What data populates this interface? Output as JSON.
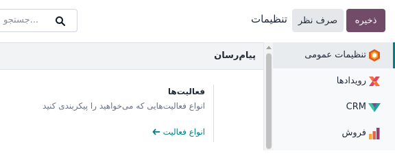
{
  "control_panel": {
    "save_label": "ذخیره",
    "discard_label": "صرف نظر",
    "title": "تنظیمات",
    "search_placeholder": "جستجو..."
  },
  "sidebar": {
    "items": [
      {
        "label": "تنظیمات عمومی",
        "icon": "settings-hex-icon",
        "active": true
      },
      {
        "label": "رویدادها",
        "icon": "events-icon",
        "active": false
      },
      {
        "label": "CRM",
        "icon": "crm-icon",
        "active": false
      },
      {
        "label": "فروش",
        "icon": "sales-icon",
        "active": false
      }
    ]
  },
  "section": {
    "title": "پیام‌رسان",
    "setting": {
      "title": "فعالیت‌ها",
      "description": "انواع فعالیت‌هایی که می‌خواهید را پیکربندی کنید",
      "link_label": "انواع فعالیت"
    }
  },
  "colors": {
    "primary": "#714b67",
    "accent": "#017e84",
    "section_bg": "#f1f3f5",
    "sidebar_bg": "#f8f9fa"
  }
}
